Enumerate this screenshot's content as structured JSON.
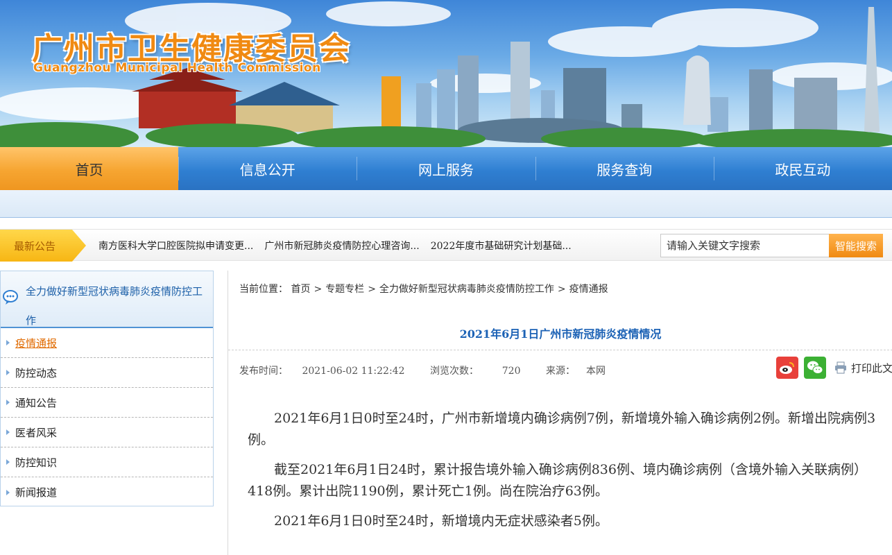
{
  "header": {
    "title": "广州市卫生健康委员会",
    "subtitle": "Guangzhou Municipal Health Commission"
  },
  "nav": {
    "items": [
      "首页",
      "信息公开",
      "网上服务",
      "服务查询",
      "政民互动"
    ],
    "active": "首页"
  },
  "notices": {
    "label": "最新公告",
    "items": [
      "南方医科大学口腔医院拟申请变更...",
      "广州市新冠肺炎疫情防控心理咨询...",
      "2022年度市基础研究计划基础..."
    ]
  },
  "search": {
    "placeholder": "请输入关键文字搜索",
    "button": "智能搜索"
  },
  "sidebar": {
    "title": "全力做好新型冠状病毒肺炎疫情防控工作",
    "items": [
      "疫情通报",
      "防控动态",
      "通知公告",
      "医者风采",
      "防控知识",
      "新闻报道"
    ],
    "current": "疫情通报"
  },
  "breadcrumb": {
    "label": "当前位置：",
    "items": [
      "首页",
      "专题专栏",
      "全力做好新型冠状病毒肺炎疫情防控工作",
      "疫情通报"
    ],
    "separator": ">"
  },
  "article": {
    "title": "2021年6月1日广州市新冠肺炎疫情情况",
    "publish_label": "发布时间：",
    "publish_time": "2021-06-02 11:22:42",
    "views_label": "浏览次数：",
    "views": "720",
    "source_label": "来源：",
    "source": "本网",
    "print_label": "打印此文",
    "paragraphs": [
      "2021年6月1日0时至24时，广州市新增境内确诊病例7例，新增境外输入确诊病例2例。新增出院病例3例。",
      "截至2021年6月1日24时，累计报告境外输入确诊病例836例、境内确诊病例（含境外输入关联病例）418例。累计出院1190例，累计死亡1例。尚在院治疗63例。",
      "2021年6月1日0时至24时，新增境内无症状感染者5例。"
    ]
  },
  "icons": {
    "share_weibo": "weibo-icon",
    "share_wechat": "wechat-icon",
    "print": "printer-icon",
    "sidebar": "chat-bubble-icon"
  },
  "colors": {
    "nav_blue": "#2f7fd2",
    "nav_active": "#f6a531",
    "title_orange": "#f08a12",
    "link_blue": "#1c62b5",
    "current_orange": "#e06a00"
  }
}
